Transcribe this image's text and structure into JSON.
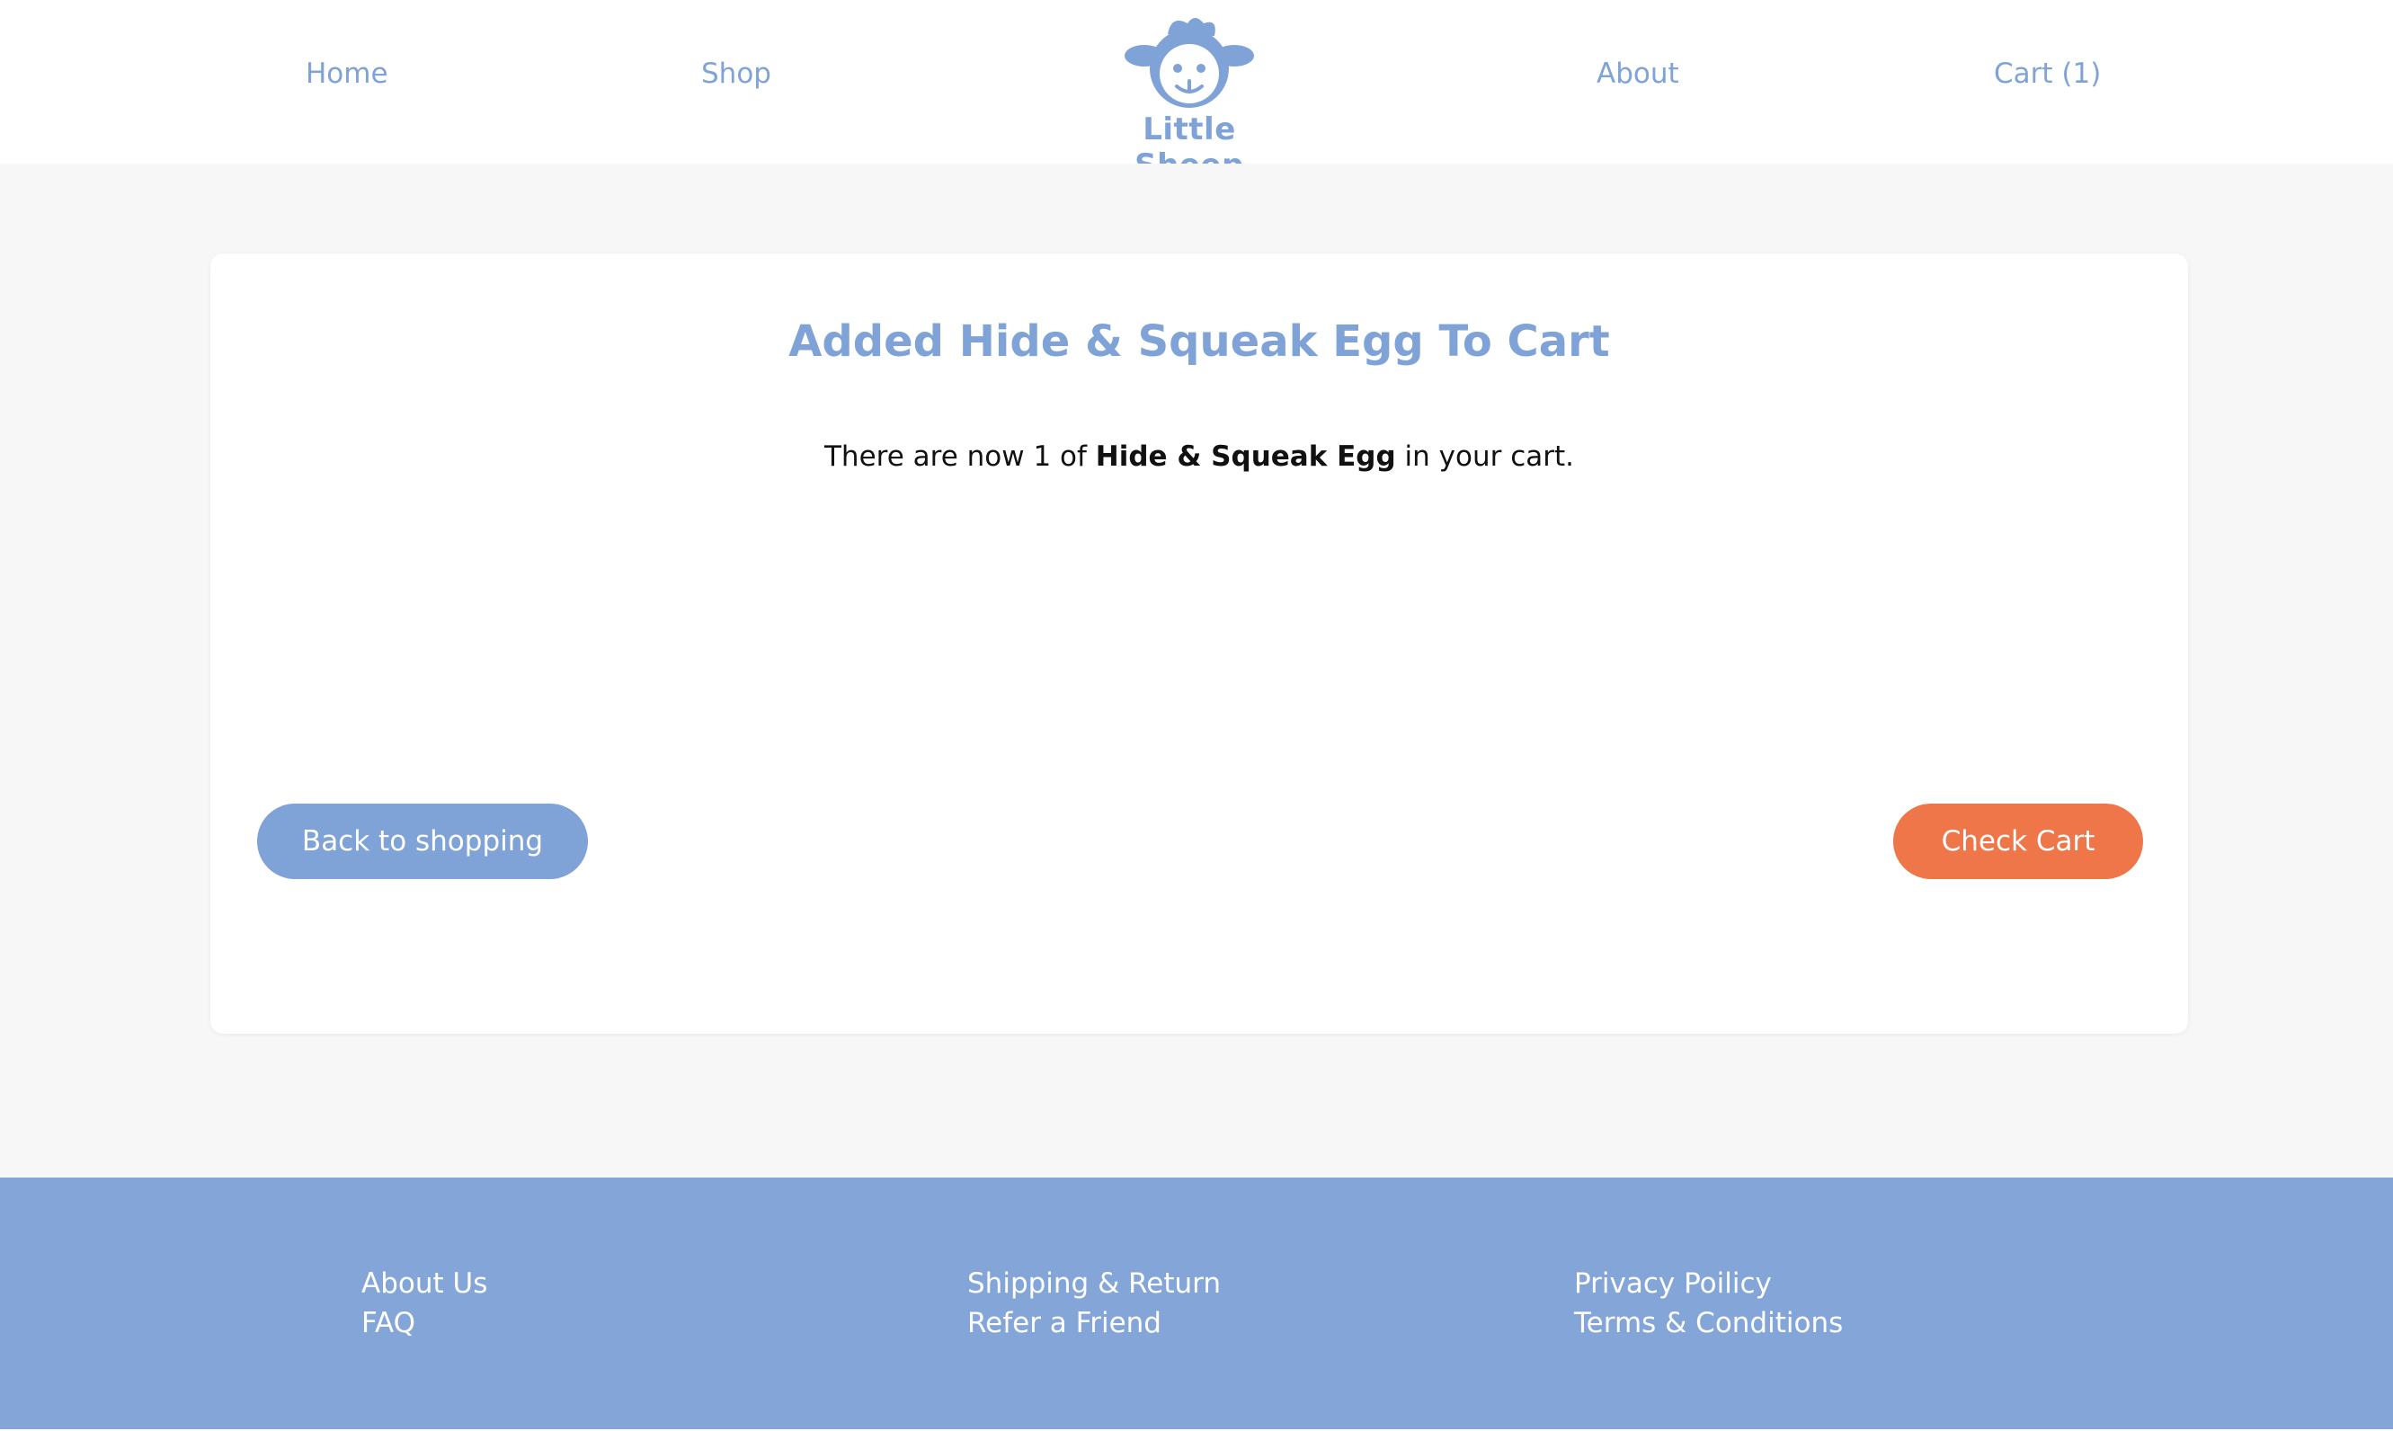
{
  "header": {
    "nav_left": [
      "Home",
      "Shop"
    ],
    "nav_right": [
      "About",
      "Cart (1)"
    ],
    "logo_text": "Little Sheep",
    "logo_icon": "sheep-logo-icon"
  },
  "card": {
    "title": "Added Hide & Squeak Egg To Cart",
    "message_prefix": "There are now 1 of ",
    "message_product": "Hide & Squeak Egg",
    "message_suffix": " in your cart.",
    "back_button": "Back to shopping",
    "check_cart_button": "Check Cart"
  },
  "footer": {
    "columns": [
      [
        "About Us",
        "FAQ"
      ],
      [
        "Shipping & Return",
        "Refer a Friend"
      ],
      [
        "Privacy Poilicy",
        "Terms & Conditions"
      ]
    ]
  },
  "colors": {
    "brand_blue": "#7fa3d7",
    "footer_blue": "#84a5d8",
    "accent_orange": "#ef7648",
    "page_bg": "#f7f7f7"
  }
}
